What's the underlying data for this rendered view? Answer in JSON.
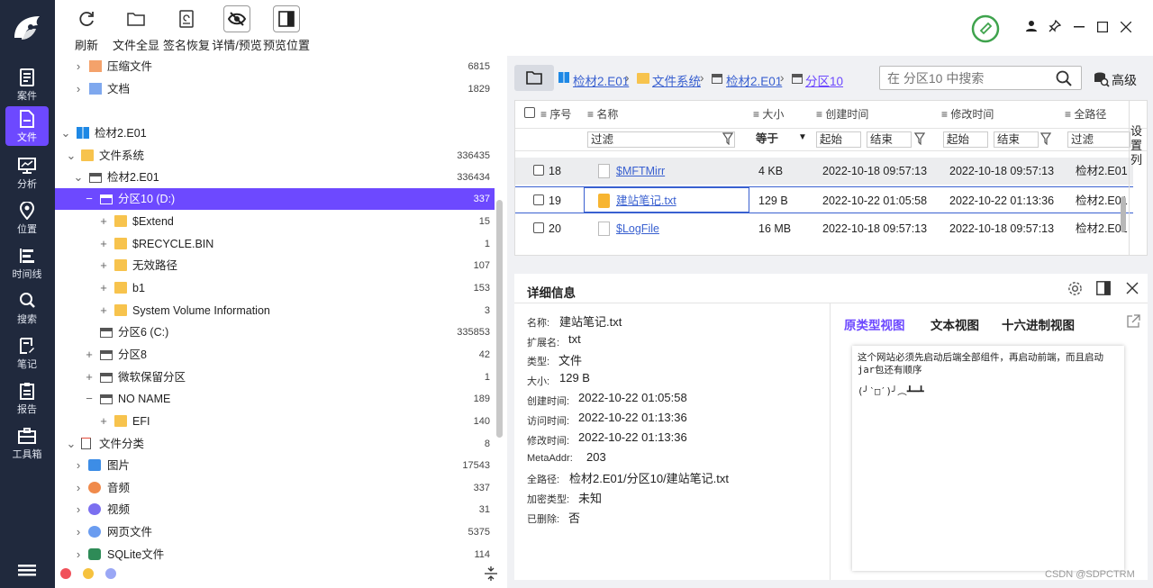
{
  "nav": {
    "items": [
      {
        "label": "案件",
        "icon": "case-icon"
      },
      {
        "label": "文件",
        "icon": "file-icon",
        "active": true
      },
      {
        "label": "分析",
        "icon": "analysis-icon"
      },
      {
        "label": "位置",
        "icon": "location-icon"
      },
      {
        "label": "时间线",
        "icon": "timeline-icon"
      },
      {
        "label": "搜索",
        "icon": "search-icon"
      },
      {
        "label": "笔记",
        "icon": "notes-icon"
      },
      {
        "label": "报告",
        "icon": "report-icon"
      },
      {
        "label": "工具箱",
        "icon": "toolbox-icon"
      }
    ]
  },
  "toolbar": {
    "refresh": "刷新",
    "show_all": "文件全显",
    "sig_restore": "签名恢复",
    "detail_preview": "详情/预览",
    "preview_pos": "预览位置"
  },
  "tree": [
    {
      "label": "压缩文件",
      "count": "6815"
    },
    {
      "label": "文档",
      "count": "1829"
    },
    {
      "label": "检材2.E01",
      "count": ""
    },
    {
      "label": "文件系统",
      "count": "336435"
    },
    {
      "label": "检材2.E01",
      "count": "336434"
    },
    {
      "label": "分区10 (D:)",
      "count": "337"
    },
    {
      "label": "$Extend",
      "count": "15"
    },
    {
      "label": "$RECYCLE.BIN",
      "count": "1"
    },
    {
      "label": "无效路径",
      "count": "107"
    },
    {
      "label": "b1",
      "count": "153"
    },
    {
      "label": "System Volume Information",
      "count": "3"
    },
    {
      "label": "分区6 (C:)",
      "count": "335853"
    },
    {
      "label": "分区8",
      "count": "42"
    },
    {
      "label": "微软保留分区",
      "count": "1"
    },
    {
      "label": "NO NAME",
      "count": "189"
    },
    {
      "label": "EFI",
      "count": "140"
    },
    {
      "label": "文件分类",
      "count": "8"
    },
    {
      "label": "图片",
      "count": "17543"
    },
    {
      "label": "音频",
      "count": "337"
    },
    {
      "label": "视频",
      "count": "31"
    },
    {
      "label": "网页文件",
      "count": "5375"
    },
    {
      "label": "SQLite文件",
      "count": "114"
    }
  ],
  "path": {
    "crumbs": [
      "检材2.E01",
      "文件系统",
      "检材2.E01",
      "分区10"
    ],
    "search_placeholder": "在 分区10 中搜索",
    "advanced": "高级"
  },
  "grid": {
    "headers": [
      "序号",
      "名称",
      "大小",
      "创建时间",
      "修改时间",
      "全路径"
    ],
    "filters": [
      "过滤",
      "等于",
      "起始",
      "结束",
      "起始",
      "结束",
      "过滤"
    ],
    "settings_col": "设置列",
    "rows": [
      {
        "no": "18",
        "name": "$MFTMirr",
        "size": "4 KB",
        "created": "2022-10-18 09:57:13",
        "modified": "2022-10-18 09:57:13",
        "path": "检材2.E01"
      },
      {
        "no": "19",
        "name": "建站笔记.txt",
        "size": "129 B",
        "created": "2022-10-22 01:05:58",
        "modified": "2022-10-22 01:13:36",
        "path": "检材2.E01"
      },
      {
        "no": "20",
        "name": "$LogFile",
        "size": "16 MB",
        "created": "2022-10-18 09:57:13",
        "modified": "2022-10-18 09:57:13",
        "path": "检材2.E01"
      }
    ]
  },
  "detail": {
    "title": "详细信息",
    "fields": [
      {
        "label": "名称:",
        "value": "建站笔记.txt"
      },
      {
        "label": "扩展名:",
        "value": "txt"
      },
      {
        "label": "类型:",
        "value": "文件"
      },
      {
        "label": "大小:",
        "value": "129 B"
      },
      {
        "label": "创建时间:",
        "value": "2022-10-22 01:05:58"
      },
      {
        "label": "访问时间:",
        "value": "2022-10-22 01:13:36"
      },
      {
        "label": "修改时间:",
        "value": "2022-10-22 01:13:36"
      },
      {
        "label": "MetaAddr:",
        "value": "203"
      },
      {
        "label": "全路径:",
        "value": "检材2.E01/分区10/建站笔记.txt"
      },
      {
        "label": "加密类型:",
        "value": "未知"
      },
      {
        "label": "已删除:",
        "value": "否"
      }
    ],
    "view_tabs": [
      "原类型视图",
      "文本视图",
      "十六进制视图"
    ],
    "preview_text": "这个网站必须先启动后端全部组件，再启动前端，而且启动jar包还有顺序",
    "preview_emoji": "(╯‵□′)╯︵┻━┻"
  },
  "watermark": "CSDN @SDPCTRM",
  "colors": {
    "accent": "#6d49ff",
    "nav_bg": "#20293d",
    "link": "#3960d0",
    "folder": "#f7c34d"
  }
}
